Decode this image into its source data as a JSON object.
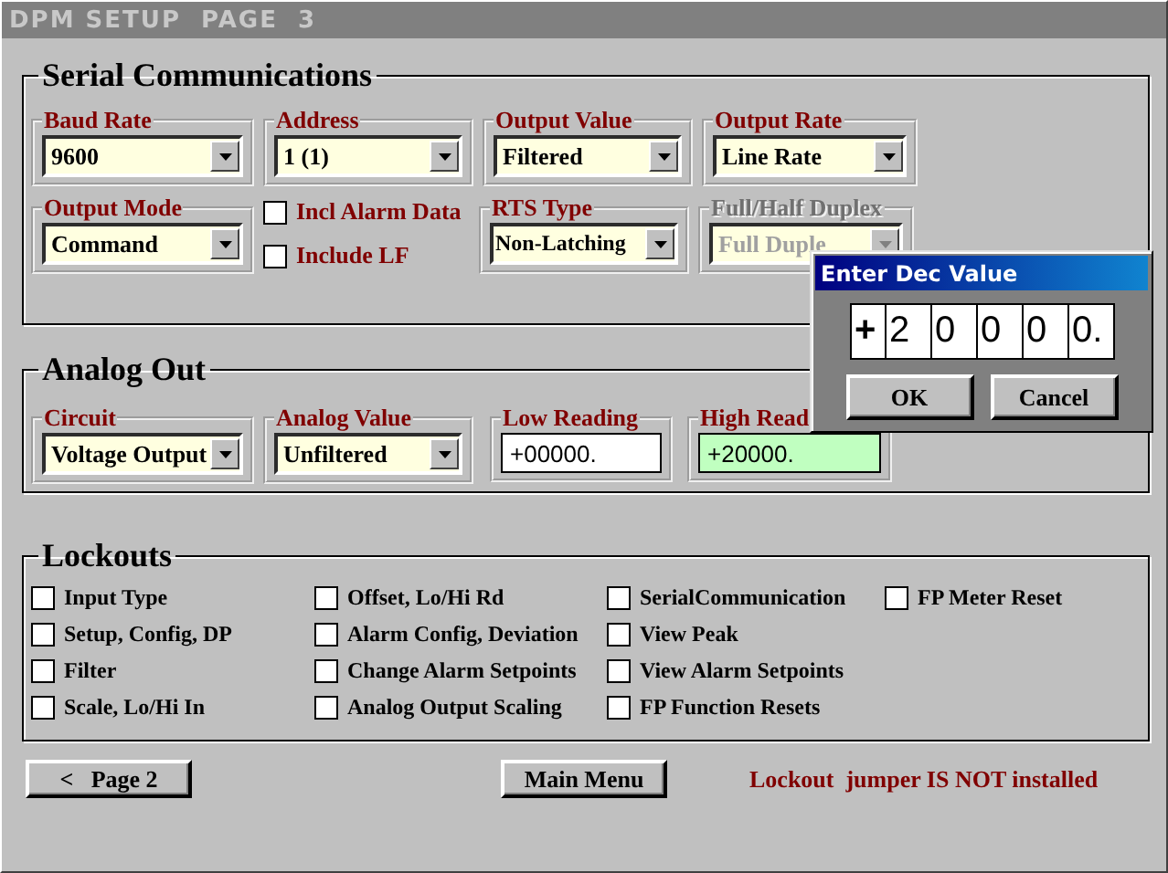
{
  "window": {
    "title": "DPM SETUP  PAGE  3"
  },
  "serial_communications": {
    "title": "Serial Communications",
    "rows": [
      [
        {
          "kind": "dropdown",
          "label": "Baud Rate",
          "value": "9600",
          "disabled": false
        },
        {
          "kind": "dropdown",
          "label": "Address",
          "value": "1 (1)",
          "disabled": false
        },
        {
          "kind": "dropdown",
          "label": "Output Value",
          "value": "Filtered",
          "disabled": false
        },
        {
          "kind": "dropdown",
          "label": "Output Rate",
          "value": "Line Rate",
          "disabled": false
        }
      ],
      [
        {
          "kind": "dropdown",
          "label": "Output Mode",
          "value": "Command",
          "disabled": false
        },
        {
          "kind": "checkboxes",
          "items": [
            {
              "label": "Incl Alarm Data",
              "checked": false
            },
            {
              "label": "Include LF",
              "checked": false
            }
          ]
        },
        {
          "kind": "dropdown",
          "label": "RTS Type",
          "value": "Non-Latching",
          "disabled": false
        },
        {
          "kind": "dropdown",
          "label": "Full/Half Duplex",
          "value": "Full Duple",
          "disabled": true
        }
      ]
    ]
  },
  "analog_out": {
    "title": "Analog Out",
    "fields": [
      {
        "kind": "dropdown",
        "label": "Circuit",
        "value": "Voltage Output",
        "disabled": false
      },
      {
        "kind": "dropdown",
        "label": "Analog Value",
        "value": "Unfiltered",
        "disabled": false
      },
      {
        "kind": "entry",
        "label": "Low Reading",
        "value": "+00000.",
        "highlighted": false
      },
      {
        "kind": "entry",
        "label": "High Read",
        "value": "+20000.",
        "highlighted": true
      }
    ]
  },
  "lockouts": {
    "title": "Lockouts",
    "columns": [
      [
        {
          "label": "Input Type",
          "checked": false
        },
        {
          "label": "Setup, Config, DP",
          "checked": false
        },
        {
          "label": "Filter",
          "checked": false
        },
        {
          "label": "Scale, Lo/Hi In",
          "checked": false
        }
      ],
      [
        {
          "label": "Offset, Lo/Hi Rd",
          "checked": false
        },
        {
          "label": "Alarm Config, Deviation",
          "checked": false
        },
        {
          "label": "Change Alarm Setpoints",
          "checked": false
        },
        {
          "label": "Analog Output Scaling",
          "checked": false
        }
      ],
      [
        {
          "label": "SerialCommunication",
          "checked": false
        },
        {
          "label": "View Peak",
          "checked": false
        },
        {
          "label": "View Alarm Setpoints",
          "checked": false
        },
        {
          "label": "FP Function Resets",
          "checked": false
        }
      ],
      [
        {
          "label": "FP Meter Reset",
          "checked": false
        }
      ]
    ]
  },
  "footer": {
    "back_button": "<   Page 2",
    "menu_button": "Main Menu",
    "status": "Lockout  jumper IS NOT installed"
  },
  "dialog": {
    "title": "Enter Dec Value",
    "digits": [
      "+",
      "2",
      "0",
      "0",
      "0",
      "0."
    ],
    "buttons": [
      "OK",
      "Cancel"
    ]
  }
}
